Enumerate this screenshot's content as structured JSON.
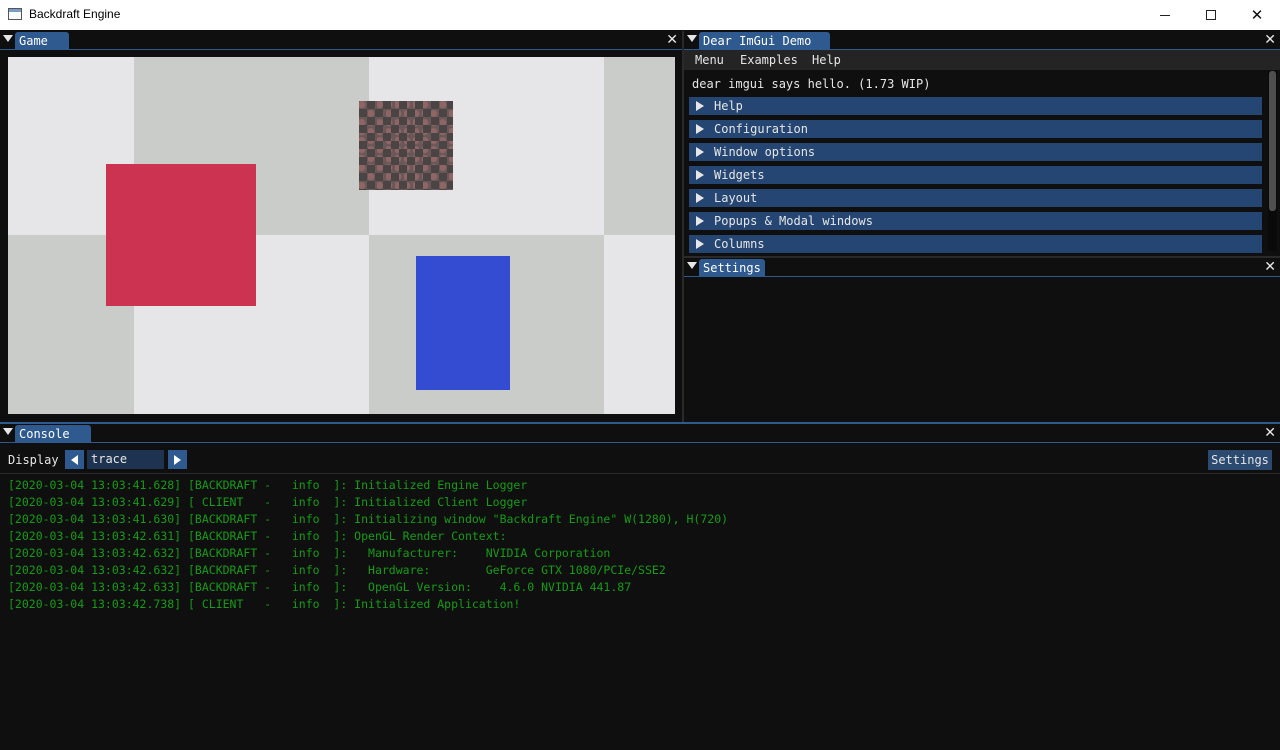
{
  "window": {
    "title": "Backdraft Engine"
  },
  "game": {
    "tab_label": "Game"
  },
  "demo": {
    "tab_label": "Dear ImGui Demo",
    "menu": [
      "Menu",
      "Examples",
      "Help"
    ],
    "hello_text": "dear imgui says hello. (1.73 WIP)",
    "sections": [
      "Help",
      "Configuration",
      "Window options",
      "Widgets",
      "Layout",
      "Popups & Modal windows",
      "Columns"
    ]
  },
  "settings": {
    "tab_label": "Settings"
  },
  "console": {
    "tab_label": "Console",
    "display_label": "Display",
    "level_value": "trace",
    "settings_button": "Settings",
    "logs": [
      "[2020-03-04 13:03:41.628] [BACKDRAFT -   info  ]: Initialized Engine Logger",
      "[2020-03-04 13:03:41.629] [ CLIENT   -   info  ]: Initialized Client Logger",
      "[2020-03-04 13:03:41.630] [BACKDRAFT -   info  ]: Initializing window \"Backdraft Engine\" W(1280), H(720)",
      "[2020-03-04 13:03:42.631] [BACKDRAFT -   info  ]: OpenGL Render Context:",
      "[2020-03-04 13:03:42.632] [BACKDRAFT -   info  ]:   Manufacturer:    NVIDIA Corporation",
      "[2020-03-04 13:03:42.632] [BACKDRAFT -   info  ]:   Hardware:        GeForce GTX 1080/PCIe/SSE2",
      "[2020-03-04 13:03:42.633] [BACKDRAFT -   info  ]:   OpenGL Version:    4.6.0 NVIDIA 441.87",
      "[2020-03-04 13:03:42.738] [ CLIENT   -   info  ]: Initialized Application!"
    ]
  },
  "colors": {
    "accent": "#2f5a8f",
    "section": "#254672",
    "log_text": "#169c16",
    "red_quad": "#cc3350",
    "blue_quad": "#334cd1"
  },
  "icons": {
    "window_menu": "triangle-down-icon",
    "close": "close-icon",
    "collapsed": "triangle-right-icon",
    "prev": "arrow-left-icon",
    "next": "arrow-right-icon"
  }
}
